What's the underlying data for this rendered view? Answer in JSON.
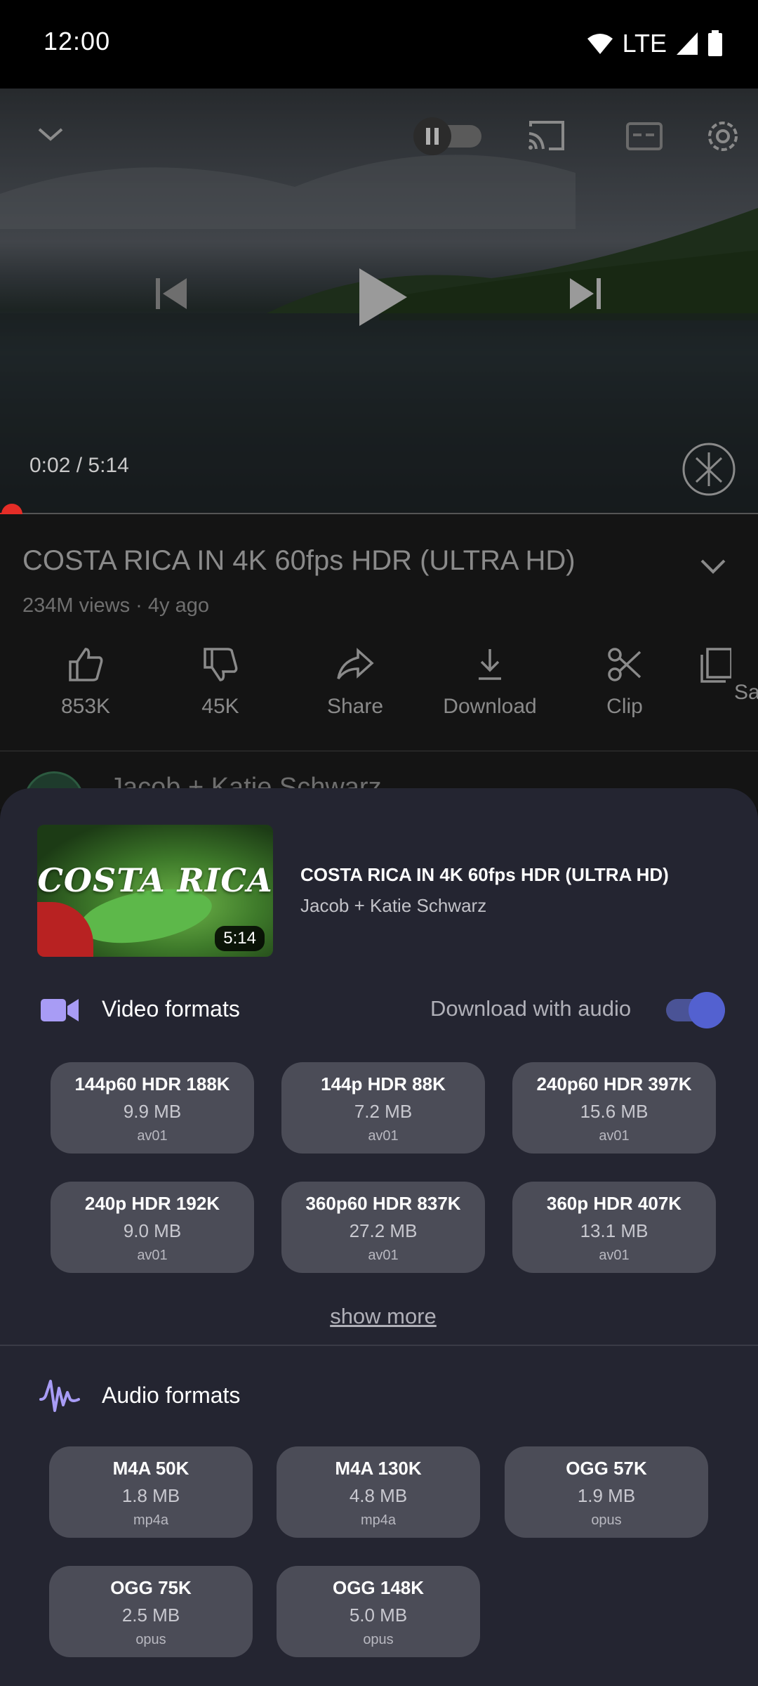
{
  "status_bar": {
    "time": "12:00",
    "network": "LTE"
  },
  "player": {
    "current_time": "0:02 / 5:14",
    "progress": 0.006
  },
  "video": {
    "title": "COSTA RICA IN 4K 60fps HDR (ULTRA HD)",
    "meta": "234M views · 4y ago",
    "actions": [
      {
        "label": "853K",
        "icon": "thumbs-up-icon"
      },
      {
        "label": "45K",
        "icon": "thumbs-down-icon"
      },
      {
        "label": "Share",
        "icon": "share-icon"
      },
      {
        "label": "Download",
        "icon": "download-icon"
      },
      {
        "label": "Clip",
        "icon": "scissors-icon"
      },
      {
        "label": "Sa",
        "icon": "save-icon"
      }
    ],
    "channel": "Jacob + Katie Schwarz"
  },
  "sheet": {
    "thumbnail_text": "COSTA RICA",
    "duration": "5:14",
    "title": "COSTA RICA IN 4K 60fps HDR (ULTRA HD)",
    "channel": "Jacob + Katie Schwarz",
    "video_section": {
      "label": "Video formats",
      "download_with_audio": "Download with audio",
      "audio_toggle_on": true,
      "formats": [
        {
          "name": "144p60 HDR 188K",
          "size": "9.9 MB",
          "codec": "av01"
        },
        {
          "name": "144p HDR 88K",
          "size": "7.2 MB",
          "codec": "av01"
        },
        {
          "name": "240p60 HDR 397K",
          "size": "15.6 MB",
          "codec": "av01"
        },
        {
          "name": "240p HDR 192K",
          "size": "9.0 MB",
          "codec": "av01"
        },
        {
          "name": "360p60 HDR 837K",
          "size": "27.2 MB",
          "codec": "av01"
        },
        {
          "name": "360p HDR 407K",
          "size": "13.1 MB",
          "codec": "av01"
        }
      ],
      "show_more": "show more"
    },
    "audio_section": {
      "label": "Audio formats",
      "formats": [
        {
          "name": "M4A 50K",
          "size": "1.8 MB",
          "codec": "mp4a"
        },
        {
          "name": "M4A 130K",
          "size": "4.8 MB",
          "codec": "mp4a"
        },
        {
          "name": "OGG 57K",
          "size": "1.9 MB",
          "codec": "opus"
        },
        {
          "name": "OGG 75K",
          "size": "2.5 MB",
          "codec": "opus"
        },
        {
          "name": "OGG 148K",
          "size": "5.0 MB",
          "codec": "opus"
        }
      ]
    }
  },
  "colors": {
    "accent": "#5361d0",
    "icon_purple": "#a89cf5",
    "progress_red": "#e52d27",
    "sheet_bg": "#242531",
    "chip_bg": "#4b4c57"
  }
}
